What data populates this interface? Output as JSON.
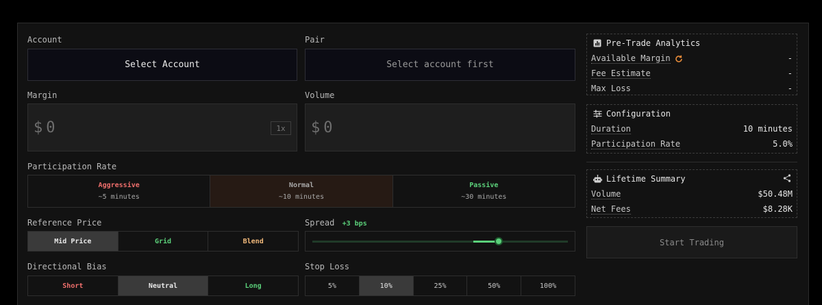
{
  "form": {
    "account": {
      "label": "Account",
      "value": "Select Account"
    },
    "pair": {
      "label": "Pair",
      "value": "Select account first"
    },
    "margin": {
      "label": "Margin",
      "currency": "$",
      "value": "0",
      "leverage": "1x"
    },
    "volume": {
      "label": "Volume",
      "currency": "$",
      "value": "0"
    },
    "participation": {
      "label": "Participation Rate",
      "options": [
        {
          "name": "Aggressive",
          "duration": "~5 minutes",
          "color": "#ef6f6c"
        },
        {
          "name": "Normal",
          "duration": "~10 minutes",
          "color": "#a9a9a9",
          "selected": true
        },
        {
          "name": "Passive",
          "duration": "~30 minutes",
          "color": "#5bd07a"
        }
      ]
    },
    "reference_price": {
      "label": "Reference Price",
      "options": [
        {
          "name": "Mid Price",
          "color": "#e8e8e8",
          "selected": true
        },
        {
          "name": "Grid",
          "color": "#5bd07a"
        },
        {
          "name": "Blend",
          "color": "#f0b87a"
        }
      ]
    },
    "spread": {
      "label": "Spread",
      "value": "+3 bps",
      "level": 0.73
    },
    "directional_bias": {
      "label": "Directional Bias",
      "options": [
        {
          "name": "Short",
          "color": "#ef6f6c"
        },
        {
          "name": "Neutral",
          "color": "#e8e8e8",
          "selected": true
        },
        {
          "name": "Long",
          "color": "#5bd07a"
        }
      ]
    },
    "stop_loss": {
      "label": "Stop Loss",
      "options": [
        "5%",
        "10%",
        "25%",
        "50%",
        "100%"
      ],
      "selected": "10%"
    }
  },
  "analytics": {
    "title": "Pre-Trade Analytics",
    "available_margin": {
      "label": "Available Margin",
      "value": "-"
    },
    "fee_estimate": {
      "label": "Fee Estimate",
      "value": "-"
    },
    "max_loss": {
      "label": "Max Loss",
      "value": "-"
    }
  },
  "configuration": {
    "title": "Configuration",
    "duration": {
      "label": "Duration",
      "value": "10 minutes"
    },
    "participation_rate": {
      "label": "Participation Rate",
      "value": "5.0%"
    }
  },
  "lifetime": {
    "title": "Lifetime Summary",
    "volume": {
      "label": "Volume",
      "value": "$50.48M"
    },
    "net_fees": {
      "label": "Net Fees",
      "value": "$8.28K"
    }
  },
  "start_button": "Start Trading",
  "colors": {
    "accent_green": "#5bd07a",
    "accent_red": "#ef6f6c",
    "accent_orange": "#e58a3a"
  }
}
